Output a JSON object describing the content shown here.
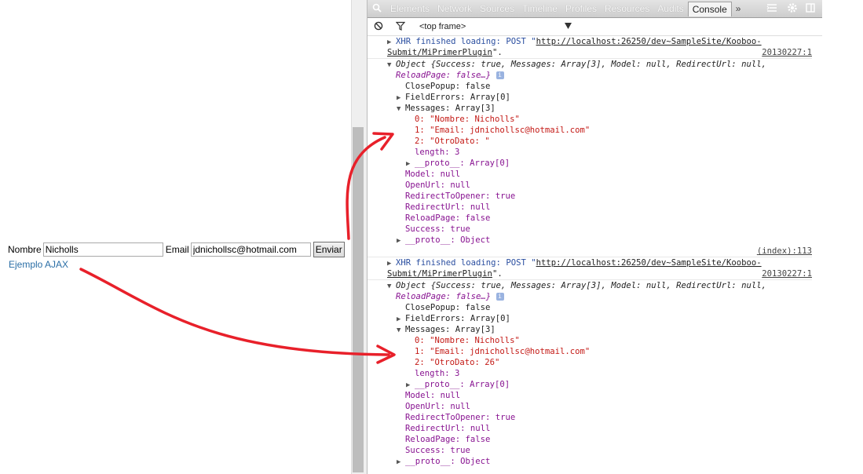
{
  "form": {
    "nombre_label": "Nombre",
    "nombre_value": "Nicholls",
    "email_label": "Email",
    "email_value": "jdnichollsc@hotmail.com",
    "submit_label": "Enviar",
    "link_label": "Ejemplo AJAX"
  },
  "devtools": {
    "tabs": [
      "Elements",
      "Network",
      "Sources",
      "Timeline",
      "Profiles",
      "Resources",
      "Audits",
      "Console"
    ],
    "active_tab": "Console",
    "overflow_icon": "»",
    "frame_select": "<top frame>",
    "icons": [
      "search-icon",
      "clear-console-icon",
      "filter-icon",
      "dropdown-arrow-icon",
      "execution-icon",
      "gear-icon",
      "dock-icon"
    ]
  },
  "console": {
    "entries": [
      {
        "xhr_prefix": "XHR finished loading: POST \"",
        "url_part1": "http://localhost:26250/dev~SampleSite/Kooboo-",
        "url_part2": "Submit/MiPrimerPlugin",
        "suffix": "\".",
        "source": "20130227:1",
        "object_summary_1": "Object {Success: true, Messages: Array[3], Model: null, RedirectUrl: null,",
        "object_summary_2": "ReloadPage: false…}",
        "close_popup": "ClosePopup: false",
        "field_errors": "FieldErrors: Array[0]",
        "messages": "Messages: Array[3]",
        "msg0": "0: \"Nombre: Nicholls\"",
        "msg1": "1: \"Email: jdnichollsc@hotmail.com\"",
        "msg2": "2: \"OtroDato: \"",
        "length": "length: 3",
        "proto_array": "__proto__: Array[0]",
        "model": "Model: null",
        "open_url": "OpenUrl: null",
        "redirect_to_opener": "RedirectToOpener: true",
        "redirect_url": "RedirectUrl: null",
        "reload_page": "ReloadPage: false",
        "success": "Success: true",
        "proto_object": "__proto__: Object",
        "line_source": "(index):113"
      },
      {
        "xhr_prefix": "XHR finished loading: POST \"",
        "url_part1": "http://localhost:26250/dev~SampleSite/Kooboo-",
        "url_part2": "Submit/MiPrimerPlugin",
        "suffix": "\".",
        "source": "20130227:1",
        "object_summary_1": "Object {Success: true, Messages: Array[3], Model: null, RedirectUrl: null,",
        "object_summary_2": "ReloadPage: false…}",
        "close_popup": "ClosePopup: false",
        "field_errors": "FieldErrors: Array[0]",
        "messages": "Messages: Array[3]",
        "msg0": "0: \"Nombre: Nicholls\"",
        "msg1": "1: \"Email: jdnichollsc@hotmail.com\"",
        "msg2": "2: \"OtroDato: 26\"",
        "length": "length: 3",
        "proto_array": "__proto__: Array[0]",
        "model": "Model: null",
        "open_url": "OpenUrl: null",
        "redirect_to_opener": "RedirectToOpener: true",
        "redirect_url": "RedirectUrl: null",
        "reload_page": "ReloadPage: false",
        "success": "Success: true",
        "proto_object": "__proto__: Object"
      }
    ]
  },
  "annotation": {
    "arrow_color": "#e8202a"
  }
}
